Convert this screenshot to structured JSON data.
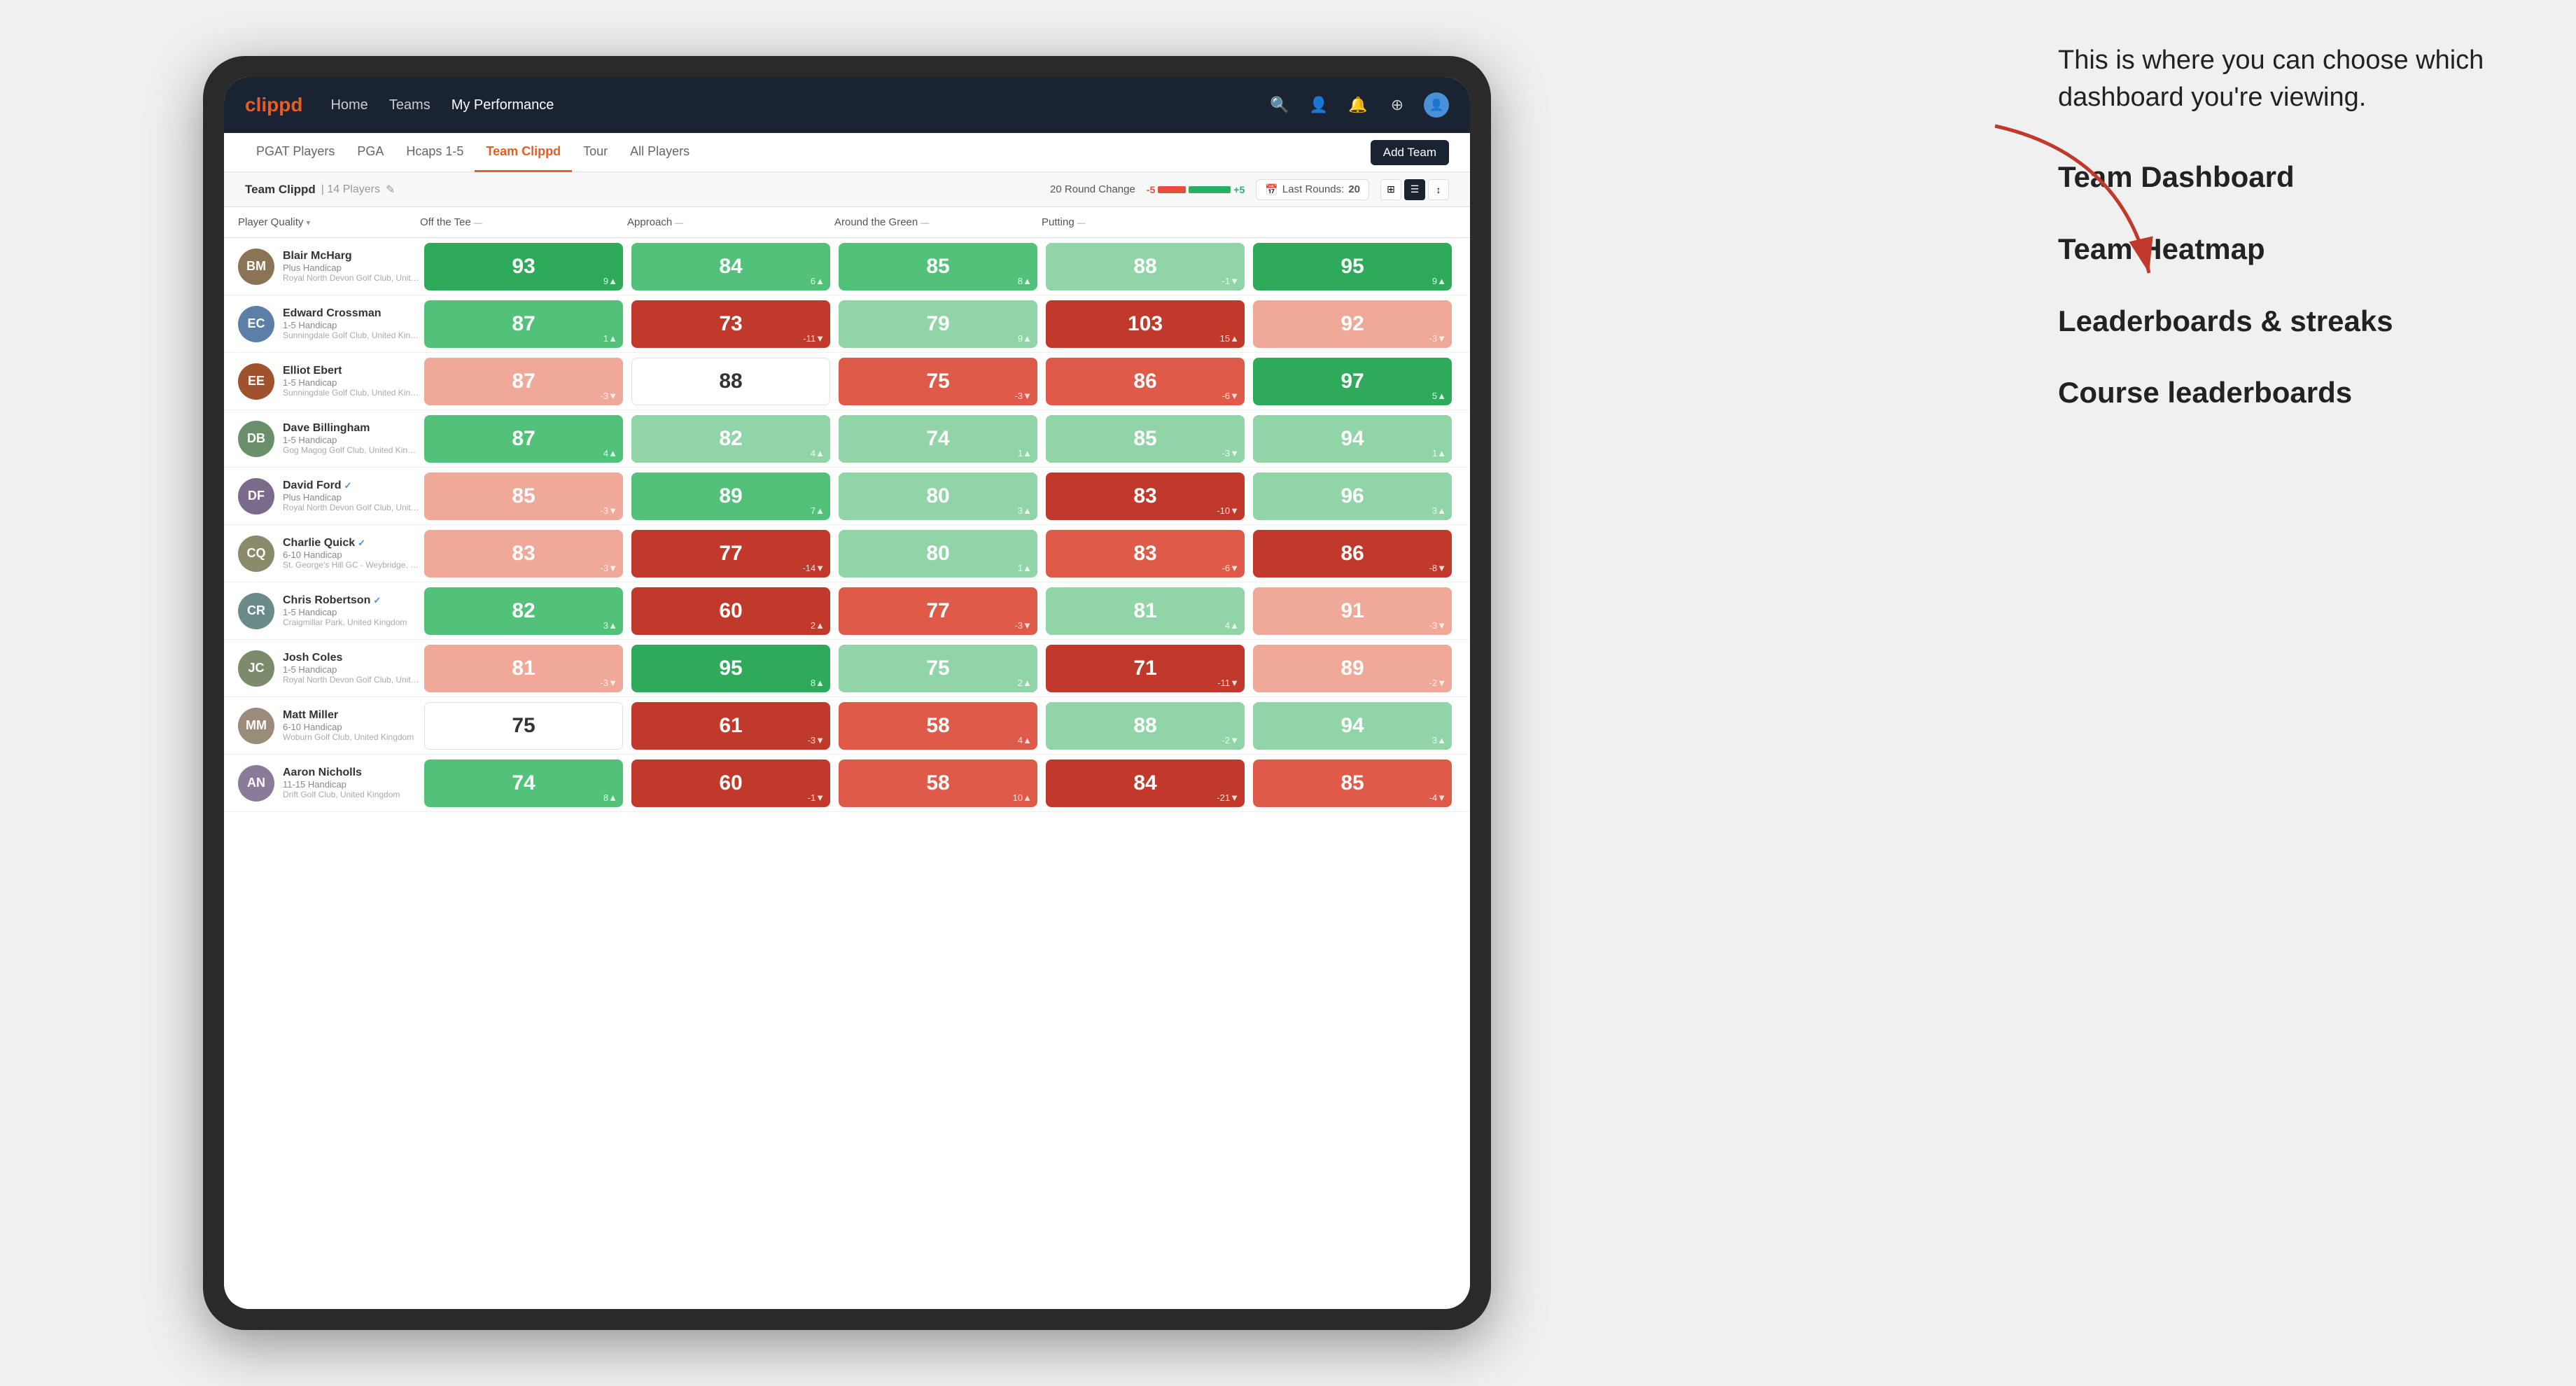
{
  "annotation": {
    "intro": "This is where you can choose which dashboard you're viewing.",
    "options": [
      "Team Dashboard",
      "Team Heatmap",
      "Leaderboards & streaks",
      "Course leaderboards"
    ]
  },
  "nav": {
    "logo": "clippd",
    "links": [
      "Home",
      "Teams",
      "My Performance"
    ],
    "active_link": "My Performance",
    "icons": [
      "🔍",
      "👤",
      "🔔",
      "⊕",
      "👤"
    ]
  },
  "tabs": [
    {
      "label": "PGAT Players",
      "active": false
    },
    {
      "label": "PGA",
      "active": false
    },
    {
      "label": "Hcaps 1-5",
      "active": false
    },
    {
      "label": "Team Clippd",
      "active": true
    },
    {
      "label": "Tour",
      "active": false
    },
    {
      "label": "All Players",
      "active": false
    }
  ],
  "add_team_label": "Add Team",
  "team": {
    "name": "Team Clippd",
    "count": "14 Players",
    "round_change_label": "20 Round Change",
    "change_neg": "-5",
    "change_pos": "+5",
    "last_rounds_label": "Last Rounds:",
    "last_rounds_value": "20"
  },
  "columns": [
    {
      "label": "Player Quality",
      "sortable": true
    },
    {
      "label": "Off the Tee",
      "sortable": true
    },
    {
      "label": "Approach",
      "sortable": true
    },
    {
      "label": "Around the Green",
      "sortable": true
    },
    {
      "label": "Putting",
      "sortable": true
    }
  ],
  "players": [
    {
      "name": "Blair McHarg",
      "handicap": "Plus Handicap",
      "club": "Royal North Devon Golf Club, United Kingdom",
      "avatar_color": "#8B7355",
      "initials": "BM",
      "stats": [
        {
          "value": "93",
          "change": "9▲",
          "color": "green-dark"
        },
        {
          "value": "84",
          "change": "6▲",
          "color": "green-mid"
        },
        {
          "value": "85",
          "change": "8▲",
          "color": "green-mid"
        },
        {
          "value": "88",
          "change": "-1▼",
          "color": "green-light"
        },
        {
          "value": "95",
          "change": "9▲",
          "color": "green-dark"
        }
      ]
    },
    {
      "name": "Edward Crossman",
      "handicap": "1-5 Handicap",
      "club": "Sunningdale Golf Club, United Kingdom",
      "avatar_color": "#5B7FA6",
      "initials": "EC",
      "stats": [
        {
          "value": "87",
          "change": "1▲",
          "color": "green-mid"
        },
        {
          "value": "73",
          "change": "-11▼",
          "color": "red-dark"
        },
        {
          "value": "79",
          "change": "9▲",
          "color": "green-light"
        },
        {
          "value": "103",
          "change": "15▲",
          "color": "red-dark"
        },
        {
          "value": "92",
          "change": "-3▼",
          "color": "red-light"
        }
      ]
    },
    {
      "name": "Elliot Ebert",
      "handicap": "1-5 Handicap",
      "club": "Sunningdale Golf Club, United Kingdom",
      "avatar_color": "#A0522D",
      "initials": "EE",
      "stats": [
        {
          "value": "87",
          "change": "-3▼",
          "color": "red-light"
        },
        {
          "value": "88",
          "change": "",
          "color": "white"
        },
        {
          "value": "75",
          "change": "-3▼",
          "color": "red-mid"
        },
        {
          "value": "86",
          "change": "-6▼",
          "color": "red-mid"
        },
        {
          "value": "97",
          "change": "5▲",
          "color": "green-dark"
        }
      ]
    },
    {
      "name": "Dave Billingham",
      "handicap": "1-5 Handicap",
      "club": "Gog Magog Golf Club, United Kingdom",
      "avatar_color": "#6B8E6B",
      "initials": "DB",
      "stats": [
        {
          "value": "87",
          "change": "4▲",
          "color": "green-mid"
        },
        {
          "value": "82",
          "change": "4▲",
          "color": "green-light"
        },
        {
          "value": "74",
          "change": "1▲",
          "color": "green-light"
        },
        {
          "value": "85",
          "change": "-3▼",
          "color": "green-light"
        },
        {
          "value": "94",
          "change": "1▲",
          "color": "green-light"
        }
      ]
    },
    {
      "name": "David Ford",
      "handicap": "Plus Handicap",
      "club": "Royal North Devon Golf Club, United Kingdom",
      "avatar_color": "#7B6B8B",
      "initials": "DF",
      "verified": true,
      "stats": [
        {
          "value": "85",
          "change": "-3▼",
          "color": "red-light"
        },
        {
          "value": "89",
          "change": "7▲",
          "color": "green-mid"
        },
        {
          "value": "80",
          "change": "3▲",
          "color": "green-light"
        },
        {
          "value": "83",
          "change": "-10▼",
          "color": "red-dark"
        },
        {
          "value": "96",
          "change": "3▲",
          "color": "green-light"
        }
      ]
    },
    {
      "name": "Charlie Quick",
      "handicap": "6-10 Handicap",
      "club": "St. George's Hill GC - Weybridge, Surrey, Uni...",
      "avatar_color": "#8B8B6B",
      "initials": "CQ",
      "verified": true,
      "stats": [
        {
          "value": "83",
          "change": "-3▼",
          "color": "red-light"
        },
        {
          "value": "77",
          "change": "-14▼",
          "color": "red-dark"
        },
        {
          "value": "80",
          "change": "1▲",
          "color": "green-light"
        },
        {
          "value": "83",
          "change": "-6▼",
          "color": "red-mid"
        },
        {
          "value": "86",
          "change": "-8▼",
          "color": "red-dark"
        }
      ]
    },
    {
      "name": "Chris Robertson",
      "handicap": "1-5 Handicap",
      "club": "Craigmillar Park, United Kingdom",
      "avatar_color": "#6B8B8B",
      "initials": "CR",
      "verified": true,
      "stats": [
        {
          "value": "82",
          "change": "3▲",
          "color": "green-mid"
        },
        {
          "value": "60",
          "change": "2▲",
          "color": "red-dark"
        },
        {
          "value": "77",
          "change": "-3▼",
          "color": "red-mid"
        },
        {
          "value": "81",
          "change": "4▲",
          "color": "green-light"
        },
        {
          "value": "91",
          "change": "-3▼",
          "color": "red-light"
        }
      ]
    },
    {
      "name": "Josh Coles",
      "handicap": "1-5 Handicap",
      "club": "Royal North Devon Golf Club, United Kingdom",
      "avatar_color": "#7B8B6B",
      "initials": "JC",
      "stats": [
        {
          "value": "81",
          "change": "-3▼",
          "color": "red-light"
        },
        {
          "value": "95",
          "change": "8▲",
          "color": "green-dark"
        },
        {
          "value": "75",
          "change": "2▲",
          "color": "green-light"
        },
        {
          "value": "71",
          "change": "-11▼",
          "color": "red-dark"
        },
        {
          "value": "89",
          "change": "-2▼",
          "color": "red-light"
        }
      ]
    },
    {
      "name": "Matt Miller",
      "handicap": "6-10 Handicap",
      "club": "Woburn Golf Club, United Kingdom",
      "avatar_color": "#9B8B7B",
      "initials": "MM",
      "stats": [
        {
          "value": "75",
          "change": "",
          "color": "white"
        },
        {
          "value": "61",
          "change": "-3▼",
          "color": "red-dark"
        },
        {
          "value": "58",
          "change": "4▲",
          "color": "red-mid"
        },
        {
          "value": "88",
          "change": "-2▼",
          "color": "green-light"
        },
        {
          "value": "94",
          "change": "3▲",
          "color": "green-light"
        }
      ]
    },
    {
      "name": "Aaron Nicholls",
      "handicap": "11-15 Handicap",
      "club": "Drift Golf Club, United Kingdom",
      "avatar_color": "#8B7B9B",
      "initials": "AN",
      "stats": [
        {
          "value": "74",
          "change": "8▲",
          "color": "green-mid"
        },
        {
          "value": "60",
          "change": "-1▼",
          "color": "red-dark"
        },
        {
          "value": "58",
          "change": "10▲",
          "color": "red-mid"
        },
        {
          "value": "84",
          "change": "-21▼",
          "color": "red-dark"
        },
        {
          "value": "85",
          "change": "-4▼",
          "color": "red-mid"
        }
      ]
    }
  ]
}
